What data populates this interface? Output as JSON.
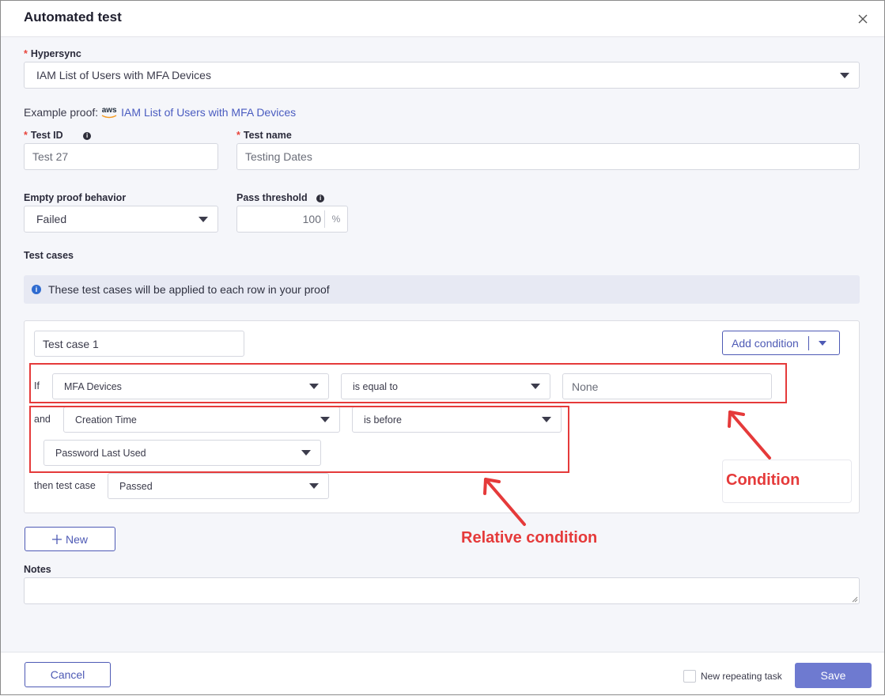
{
  "dialog": {
    "title": "Automated test",
    "close_glyph": "×"
  },
  "hypersync": {
    "label": "Hypersync",
    "value": "IAM List of Users with MFA Devices"
  },
  "example_proof": {
    "label": "Example proof:",
    "provider_logo": "aws",
    "link": "IAM List of Users with MFA Devices"
  },
  "test_id": {
    "label": "Test ID",
    "value": "Test 27"
  },
  "test_name": {
    "label": "Test name",
    "value": "Testing Dates"
  },
  "empty_proof": {
    "label": "Empty proof behavior",
    "value": "Failed"
  },
  "pass_threshold": {
    "label": "Pass threshold",
    "value": "100",
    "unit": "%"
  },
  "test_cases": {
    "label": "Test cases",
    "banner": "These test cases will be applied to each row in your proof",
    "case": {
      "name": "Test case 1",
      "add_condition": "Add condition",
      "if_label": "If",
      "if_field": "MFA Devices",
      "if_operator": "is equal to",
      "if_value": "None",
      "and_label": "and",
      "and_field": "Creation Time",
      "and_operator": "is before",
      "and_compare_field": "Password Last Used",
      "then_label": "then test case",
      "then_value": "Passed"
    },
    "new_button": "New"
  },
  "annotations": {
    "condition": "Condition",
    "relative_condition": "Relative condition",
    "color": "#e53a3a"
  },
  "notes": {
    "label": "Notes",
    "value": ""
  },
  "footer": {
    "cancel": "Cancel",
    "repeating_task": "New repeating task",
    "save": "Save"
  },
  "colors": {
    "primary": "#4e5ab5",
    "save_button": "#6e7ad0",
    "required": "#e8453c"
  }
}
